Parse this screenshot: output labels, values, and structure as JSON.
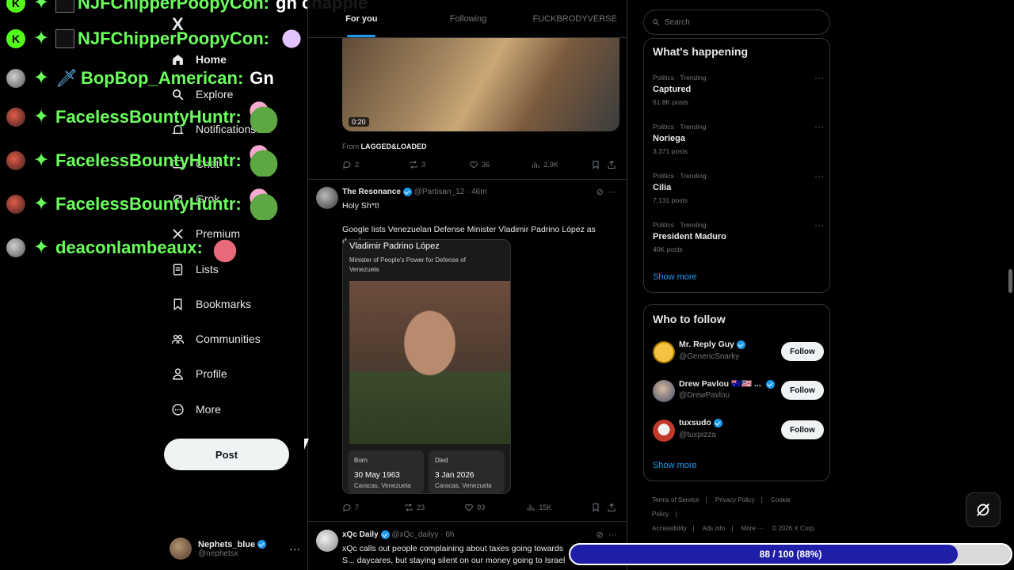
{
  "chat": {
    "lines": [
      {
        "user": "NJFChipperPoopyCon:",
        "message": "gn chappie"
      },
      {
        "user": "NJFChipperPoopyCon:",
        "message": ""
      },
      {
        "user": "BopBop_American:",
        "message": "Gn"
      },
      {
        "user": "FacelessBountyHuntr:",
        "message": ""
      },
      {
        "user": "FacelessBountyHuntr:",
        "message": ""
      },
      {
        "user": "FacelessBountyHuntr:",
        "message": ""
      },
      {
        "user": "deaconlambeaux:",
        "message": ""
      }
    ],
    "kick_badge": "K"
  },
  "nav": {
    "logo": "X",
    "items": [
      {
        "label": "Home",
        "icon": "home-icon"
      },
      {
        "label": "Explore",
        "icon": "search-icon"
      },
      {
        "label": "Notifications",
        "icon": "bell-icon"
      },
      {
        "label": "Chat",
        "icon": "chat-icon"
      },
      {
        "label": "Grok",
        "icon": "grok-icon"
      },
      {
        "label": "Premium",
        "icon": "x-icon"
      },
      {
        "label": "Lists",
        "icon": "list-icon"
      },
      {
        "label": "Bookmarks",
        "icon": "bookmark-icon"
      },
      {
        "label": "Communities",
        "icon": "communities-icon"
      },
      {
        "label": "Profile",
        "icon": "person-icon"
      },
      {
        "label": "More",
        "icon": "more-circle-icon"
      }
    ],
    "post_label": "Post",
    "account": {
      "name": "Nephets_blue",
      "handle": "@nephetsx"
    }
  },
  "feed": {
    "tabs": [
      "For you",
      "Following",
      "FUCKBRODYVERSE"
    ],
    "video": {
      "duration": "0:20",
      "from_prefix": "From",
      "from_source": "LAGGED&LOADED"
    },
    "video_actions": {
      "replies": "2",
      "reposts": "3",
      "likes": "36",
      "views": "2.9K"
    },
    "tweet1": {
      "name": "The Resonance",
      "handle": "@Partisan_12",
      "time": "· 46m",
      "line1": "Holy Sh*t!",
      "line2": "Google lists Venezuelan Defense Minister Vladimir Padrino López as dead.",
      "card": {
        "name": "Vladimir Padrino López",
        "role": "Minister of People's Power for Defense of Venezuela",
        "born_label": "Born",
        "born_date": "30 May 1963",
        "born_place": "Caracas, Venezuela",
        "died_label": "Died",
        "died_date": "3 Jan 2026",
        "died_place": "Caracas, Venezuela"
      },
      "actions": {
        "replies": "7",
        "reposts": "23",
        "likes": "93",
        "views": "15K"
      }
    },
    "tweet2": {
      "name": "xQc Daily",
      "handle": "@xQc_dailyy",
      "time": "· 6h",
      "text": "xQc calls out people complaining about taxes going towards S... daycares, but staying silent on our money going to Israel"
    }
  },
  "right": {
    "search_placeholder": "Search",
    "happening_title": "What's happening",
    "trends": [
      {
        "category": "Politics · Trending",
        "title": "Captured",
        "count": "61.8K posts"
      },
      {
        "category": "Politics · Trending",
        "title": "Noriega",
        "count": "3,371 posts"
      },
      {
        "category": "Politics · Trending",
        "title": "Cilia",
        "count": "7,131 posts"
      },
      {
        "category": "Politics · Trending",
        "title": "President Maduro",
        "count": "40K posts"
      }
    ],
    "show_more": "Show more",
    "who_title": "Who to follow",
    "who": [
      {
        "name": "Mr. Reply Guy",
        "handle": "@GenericSnarky",
        "follow": "Follow"
      },
      {
        "name": "Drew Pavlou",
        "handle": "@DrewPavlou",
        "follow": "Follow"
      },
      {
        "name": "tuxsudo",
        "handle": "@tuxpizza",
        "follow": "Follow"
      }
    ],
    "footer": [
      "Terms of Service",
      "|",
      "Privacy Policy",
      "|",
      "Cookie Policy",
      "|",
      "Accessibility",
      "|",
      "Ads info",
      "|",
      "More ···",
      "© 2026 X Corp."
    ]
  },
  "progress": {
    "text": "88 / 100 (88%)",
    "fraction": 0.88
  },
  "colors": {
    "accent": "#1d9bf0",
    "chat_user": "#6bff5c",
    "progress_fill": "#1e1ea8"
  }
}
